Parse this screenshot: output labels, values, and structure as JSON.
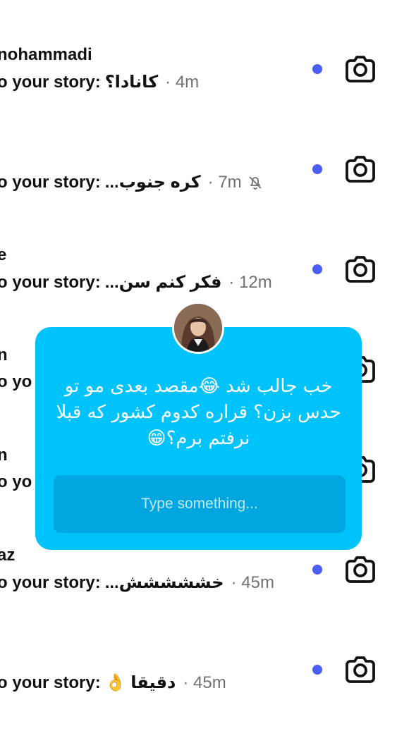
{
  "rows": [
    {
      "name": "nohammadi",
      "prefix": "o your story:",
      "message": "کانادا؟",
      "time": "· 4m",
      "muted": false
    },
    {
      "name": "",
      "prefix": "o your story:",
      "message": "کره جنوب...",
      "time": "· 7m",
      "muted": true
    },
    {
      "name": "e",
      "prefix": "o your story:",
      "message": "فکر کنم سن...",
      "time": "· 12m",
      "muted": false
    },
    {
      "name": "n",
      "prefix": "o yo",
      "message": "",
      "time": "",
      "muted": false
    },
    {
      "name": "n",
      "prefix": "o yo",
      "message": "",
      "time": "",
      "muted": false
    },
    {
      "name": "az",
      "prefix": "o your story:",
      "message": "خششششش...",
      "time": "· 45m",
      "muted": false
    },
    {
      "name": "",
      "prefix": "o your story:",
      "message": "دقیقا 👌",
      "time": "· 45m",
      "muted": false
    }
  ],
  "overlay": {
    "reply_text": "خب جالب شد 😂مقصد بعدی مو تو حدس بزن؟ قراره کدوم کشور که قبلا نرفتم برم؟😁",
    "input_placeholder": "Type something..."
  },
  "icons": {
    "unread": "unread-dot-icon",
    "camera": "camera-icon",
    "muted": "bell-off-icon"
  },
  "colors": {
    "unread_dot": "#4a5df5",
    "overlay_bg": "#00c3fb",
    "input_bg": "#00a6e0"
  }
}
